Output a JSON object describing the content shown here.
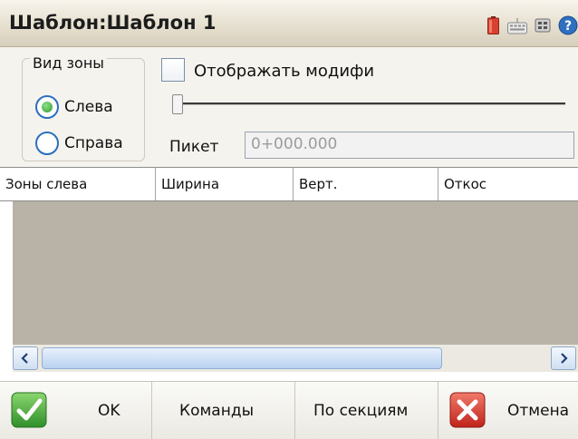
{
  "window": {
    "title": "Шаблон:Шаблон 1",
    "status_icons": [
      "battery-icon",
      "keyboard-icon",
      "network-icon",
      "help-icon"
    ]
  },
  "zone_group": {
    "legend": "Вид зоны",
    "options": [
      {
        "label": "Слева",
        "checked": true
      },
      {
        "label": "Справа",
        "checked": false
      }
    ]
  },
  "show_modified": {
    "label": "Отображать модифи",
    "checked": false
  },
  "piket": {
    "label": "Пикет",
    "value": "0+000.000"
  },
  "table": {
    "columns": [
      "Зоны слева",
      "Ширина",
      "Верт.",
      "Откос"
    ],
    "rows": []
  },
  "buttons": {
    "ok": "OK",
    "commands": "Команды",
    "by_sections": "По секциям",
    "cancel": "Отмена"
  },
  "colors": {
    "table_body": "#b8b3a6",
    "accent_blue": "#2a6fc0",
    "ok_green": "#3aa236",
    "cancel_red": "#d6322b"
  }
}
